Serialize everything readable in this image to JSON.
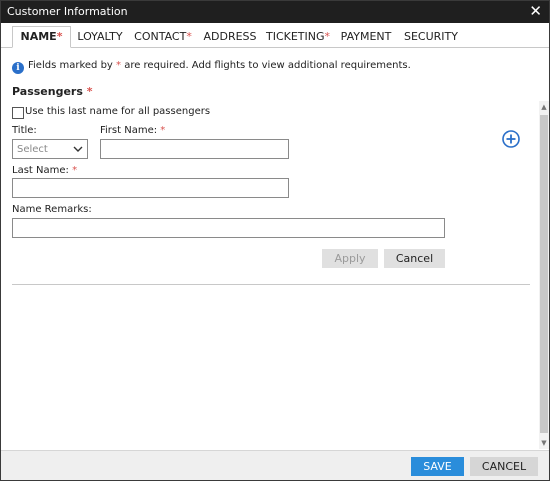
{
  "window": {
    "title": "Customer Information"
  },
  "tabs": [
    {
      "label": "NAME",
      "required": true,
      "active": true
    },
    {
      "label": "LOYALTY",
      "required": false,
      "active": false
    },
    {
      "label": "CONTACT",
      "required": true,
      "active": false
    },
    {
      "label": "ADDRESS",
      "required": false,
      "active": false
    },
    {
      "label": "TICKETING",
      "required": true,
      "active": false
    },
    {
      "label": "PAYMENT",
      "required": false,
      "active": false
    },
    {
      "label": "SECURITY",
      "required": false,
      "active": false
    }
  ],
  "required_mark": "*",
  "info": {
    "text_before": "Fields marked by ",
    "text_after": " are required. Add flights to view additional requirements.",
    "icon": "info-icon"
  },
  "passengers": {
    "title": "Passengers",
    "use_last_name_label": "Use this last name for all passengers",
    "use_last_name_checked": false,
    "title_label": "Title:",
    "title_select_value": "Select",
    "first_name_label": "First Name:",
    "first_name_value": "",
    "last_name_label": "Last Name:",
    "last_name_value": "",
    "remarks_label": "Name Remarks:",
    "remarks_value": "",
    "apply_label": "Apply",
    "cancel_label": "Cancel",
    "add_icon": "plus-circle-icon"
  },
  "footer": {
    "save_label": "SAVE",
    "cancel_label": "CANCEL"
  },
  "colors": {
    "titlebar": "#1f1f1f",
    "required": "#d9534f",
    "accent": "#2a8ddb",
    "info_icon": "#2a6fc9"
  }
}
